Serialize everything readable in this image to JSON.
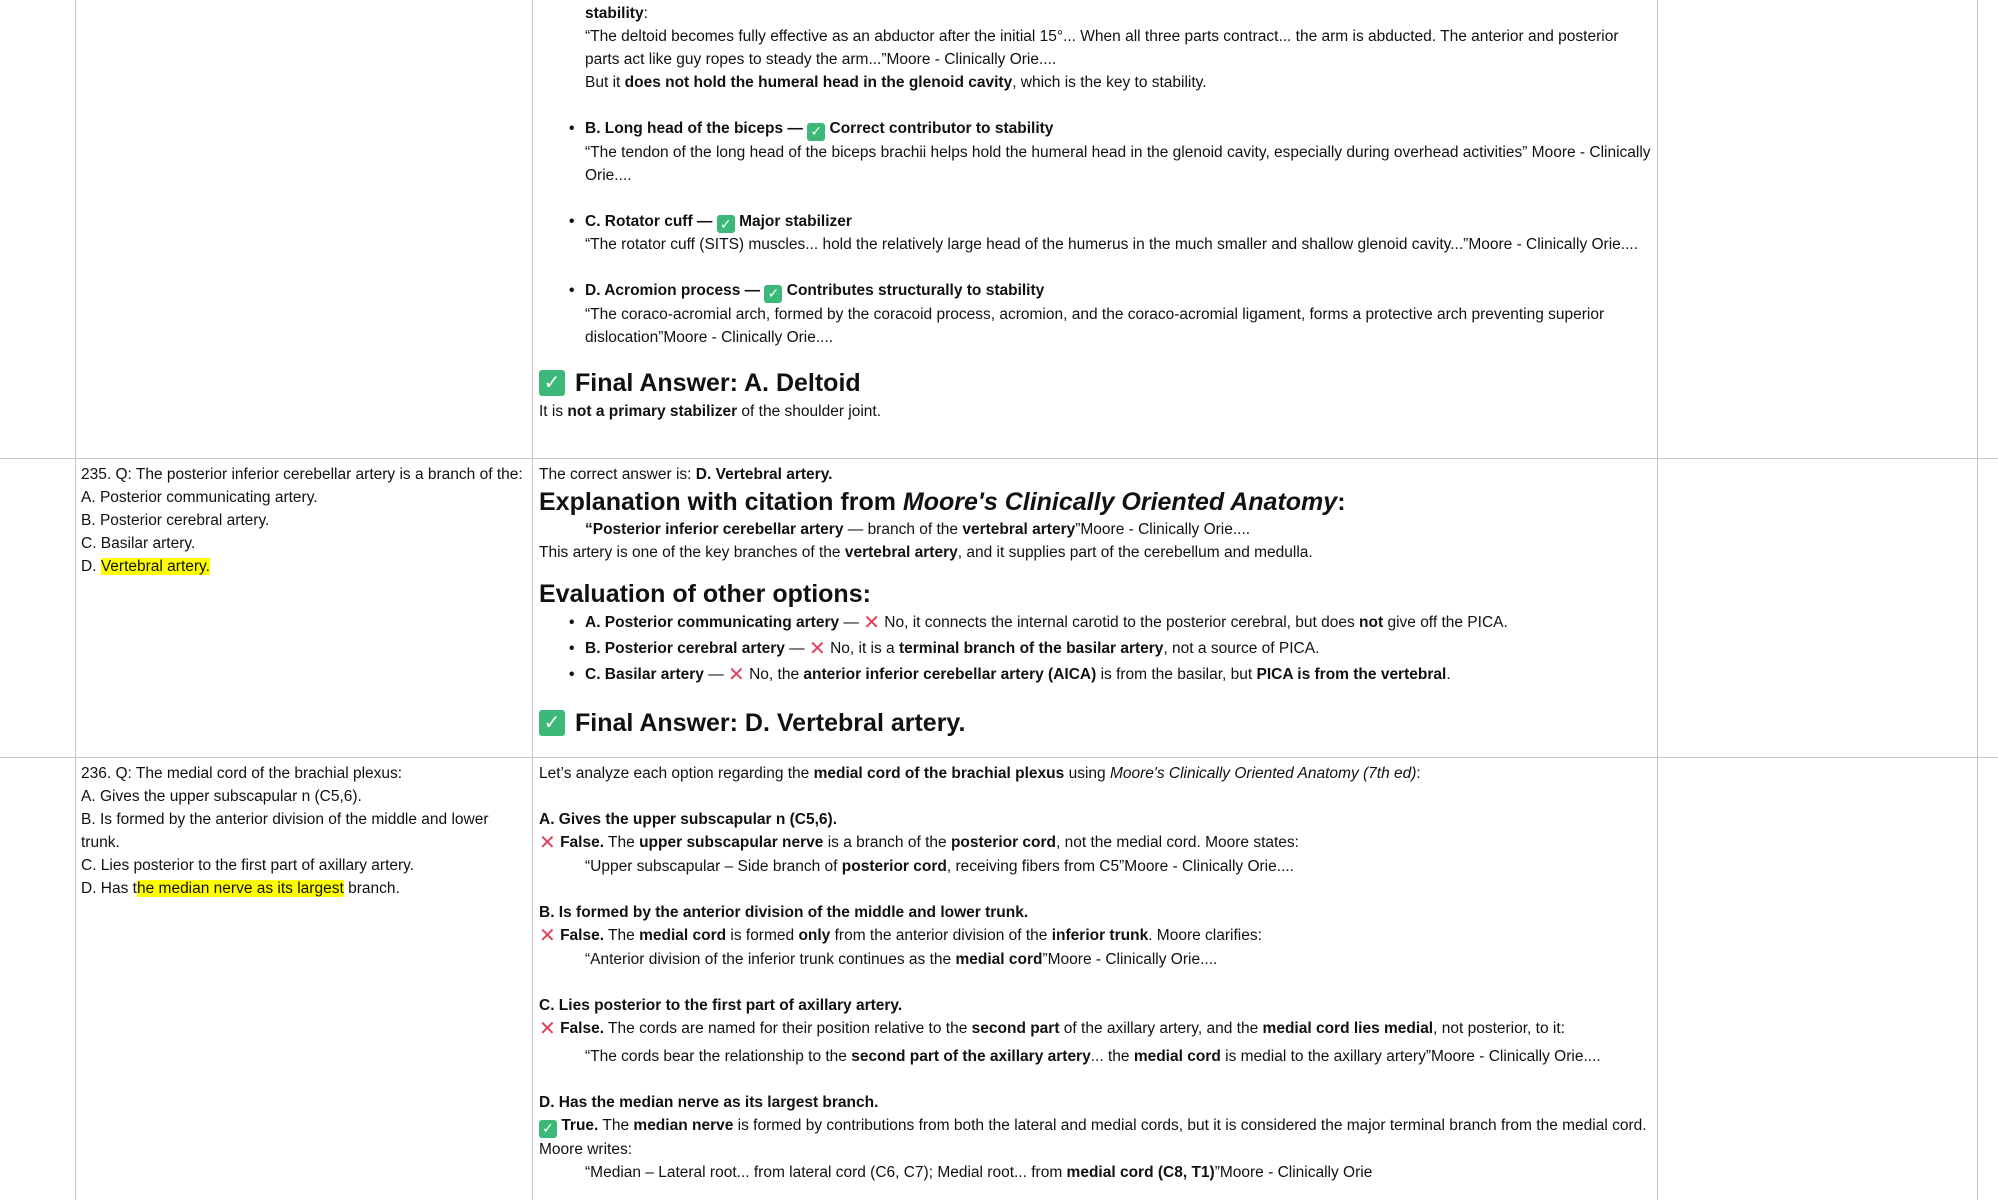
{
  "prev": {
    "stability_label": "stability",
    "deltoid_quote": "“The deltoid becomes fully effective as an abductor after the initial 15°... When all three parts contract... the arm is abducted. The anterior and posterior parts act like guy ropes to steady the arm...”Moore - Clinically Orie....",
    "deltoid_but_a": "But it ",
    "deltoid_but_b": "does not hold the humeral head in the glenoid cavity",
    "deltoid_but_c": ", which is the key to stability.",
    "b_label": "B. Long head of the biceps —",
    "b_verdict": "Correct contributor to stability",
    "b_quote": "“The tendon of the long head of the biceps brachii helps hold the humeral head in the glenoid cavity, especially during overhead activities” Moore - Clinically Orie....",
    "c_label": "C. Rotator cuff —",
    "c_verdict": "Major stabilizer",
    "c_quote": "“The rotator cuff (SITS) muscles... hold the relatively large head of the humerus in the much smaller and shallow glenoid cavity...”Moore - Clinically Orie....",
    "d_label": "D. Acromion process —",
    "d_verdict": "Contributes structurally to stability",
    "d_quote": "“The coraco-acromial arch, formed by the coracoid process, acromion, and the coraco-acromial ligament, forms a protective arch preventing superior dislocation”Moore - Clinically Orie....",
    "final": "Final Answer: A. Deltoid",
    "final_note_a": "It is ",
    "final_note_b": "not a primary stabilizer",
    "final_note_c": " of the shoulder joint."
  },
  "q235": {
    "question": "235. Q: The posterior inferior cerebellar artery is a branch of the:",
    "opt_a": "A. Posterior communicating artery.",
    "opt_b": "B. Posterior cerebral artery.",
    "opt_c": "C. Basilar artery.",
    "opt_d_prefix": "D. ",
    "opt_d_hl": "Vertebral artery.",
    "answer_prefix": "The correct answer is: ",
    "answer": "D. Vertebral artery.",
    "expl_a": "Explanation with citation from ",
    "expl_b": "Moore's Clinically Oriented Anatomy",
    "expl_c": ":",
    "cite_1": "“Posterior inferior cerebellar artery",
    "cite_2": " — branch of the ",
    "cite_3": "vertebral artery",
    "cite_4": "”Moore - Clinically Orie....",
    "note_1": "This artery is one of the key branches of the ",
    "note_2": "vertebral artery",
    "note_3": ", and it supplies part of the cerebellum and medulla.",
    "eval_heading": "Evaluation of other options:",
    "e1_label": "A. Posterior communicating artery",
    "e1_text_a": " No, it connects the internal carotid to the posterior cerebral, but does ",
    "e1_text_b": "not",
    "e1_text_c": " give off the PICA.",
    "e2_label": "B. Posterior cerebral artery",
    "e2_text_a": " No, it is a ",
    "e2_text_b": "terminal branch of the basilar artery",
    "e2_text_c": ", not a source of PICA.",
    "e3_label": "C. Basilar artery",
    "e3_text_a": " No, the ",
    "e3_text_b": "anterior inferior cerebellar artery (AICA)",
    "e3_text_c": " is from the basilar, but ",
    "e3_text_d": "PICA is from the vertebral",
    "e3_text_e": ".",
    "final": "Final Answer: D. Vertebral artery."
  },
  "q236": {
    "question": "236. Q: The medial cord of the brachial plexus:",
    "opt_a": "A. Gives the upper subscapular n (C5,6).",
    "opt_b": "B. Is formed by the anterior division of the middle and lower trunk.",
    "opt_c": "C. Lies posterior to the first part of axillary artery.",
    "opt_d_prefix": "D. Has t",
    "opt_d_hl": "he median nerve as its largest",
    "opt_d_suffix": " branch.",
    "intro_a": "Let’s analyze each option regarding the ",
    "intro_b": "medial cord of the brachial plexus",
    "intro_c": " using ",
    "intro_d": "Moore's Clinically Oriented Anatomy (7th ed)",
    "intro_e": ":",
    "a_head": "A. Gives the upper subscapular n (C5,6).",
    "a_false": "False.",
    "a_t1": " The ",
    "a_t2": "upper subscapular nerve",
    "a_t3": " is a branch of the ",
    "a_t4": "posterior cord",
    "a_t5": ", not the medial cord. Moore states:",
    "a_q1": "“Upper subscapular – Side branch of ",
    "a_q2": "posterior cord",
    "a_q3": ", receiving fibers from C5”Moore - Clinically Orie....",
    "b_head": "B. Is formed by the anterior division of the middle and lower trunk.",
    "b_false": "False.",
    "b_t1": " The ",
    "b_t2": "medial cord",
    "b_t3": " is formed ",
    "b_t4": "only",
    "b_t5": " from the anterior division of the ",
    "b_t6": "inferior trunk",
    "b_t7": ". Moore clarifies:",
    "b_q1": "“Anterior division of the inferior trunk continues as the ",
    "b_q2": "medial cord",
    "b_q3": "”Moore - Clinically Orie....",
    "c_head": "C. Lies posterior to the first part of axillary artery.",
    "c_false": "False.",
    "c_t1": " The cords are named for their position relative to the ",
    "c_t2": "second part",
    "c_t3": " of the axillary artery, and the ",
    "c_t4": "medial cord lies medial",
    "c_t5": ", not posterior, to it:",
    "c_q1": "“The cords bear the relationship to the ",
    "c_q2": "second part of the axillary artery",
    "c_q3": "... the ",
    "c_q4": "medial cord",
    "c_q5": " is medial to the axillary artery”Moore - Clinically Orie....",
    "d_head": "D. Has the median nerve as its largest branch.",
    "d_true": "True.",
    "d_t1": " The ",
    "d_t2": "median nerve",
    "d_t3": " is formed by contributions from both the lateral and medial cords, but it is considered the major terminal branch from the medial cord. Moore writes:",
    "d_q1": "“Median – Lateral root... from lateral cord (C6, C7); Medial root... from ",
    "d_q2": "medial cord (C8, T1)",
    "d_q3": "”Moore - Clinically Orie"
  }
}
